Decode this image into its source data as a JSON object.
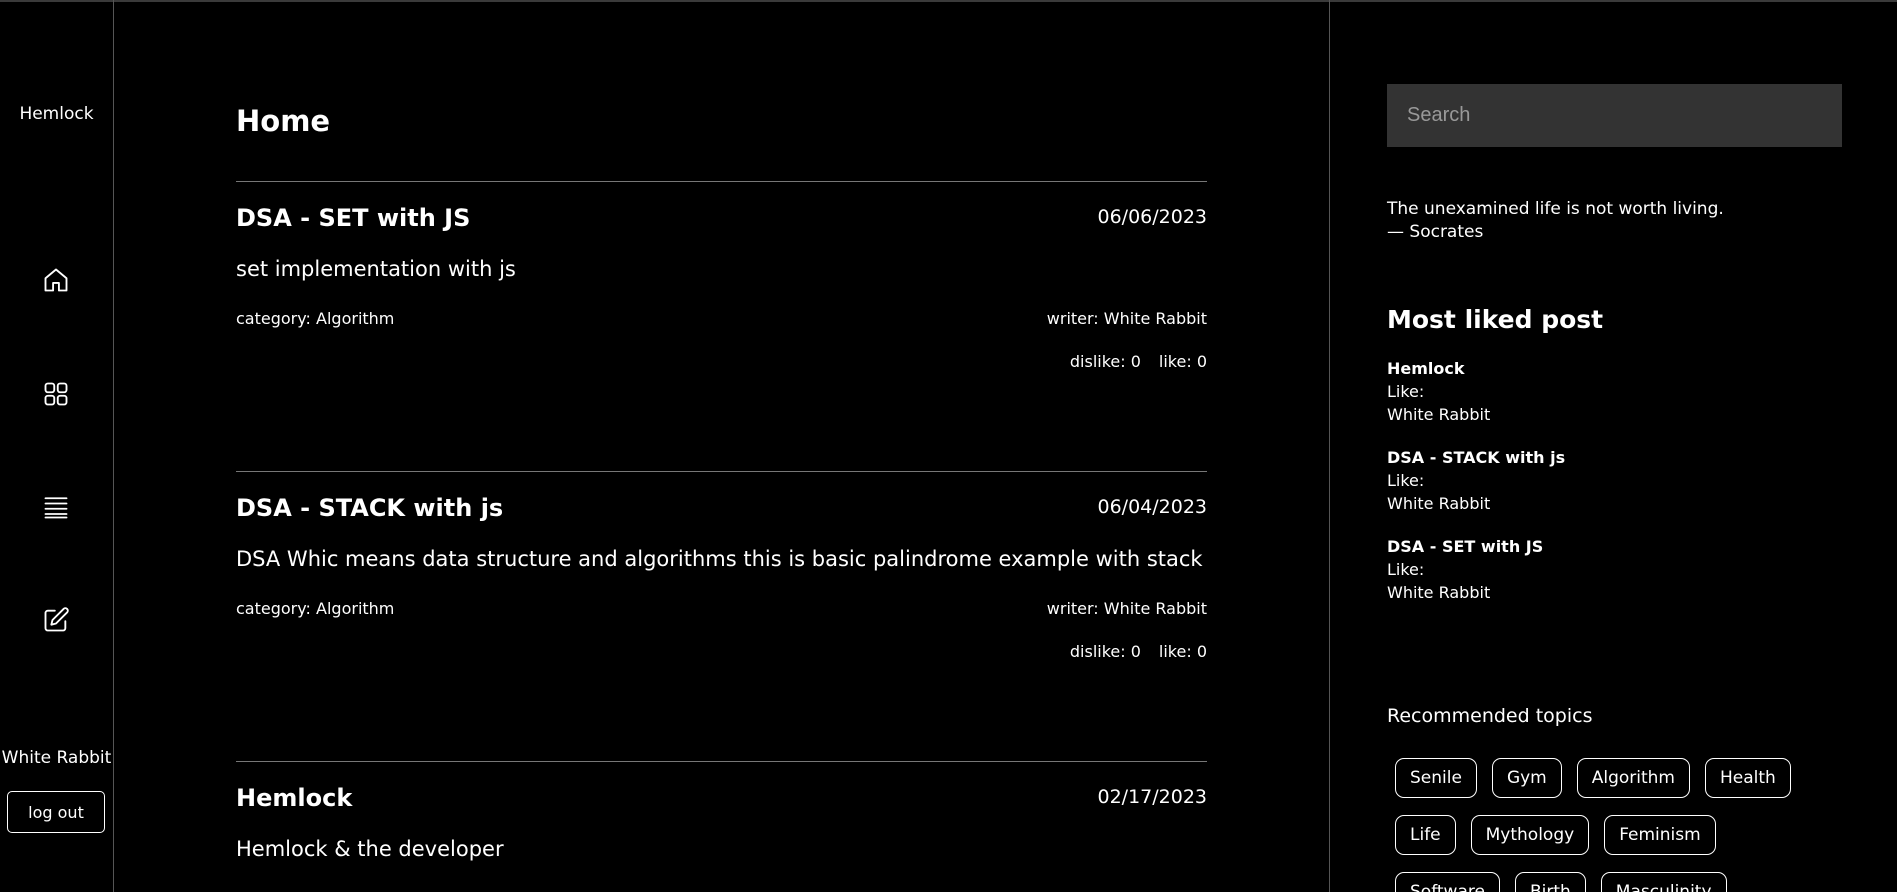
{
  "sidebar": {
    "brand": "Hemlock",
    "nav": [
      {
        "name": "home-icon"
      },
      {
        "name": "grid-icon"
      },
      {
        "name": "list-icon"
      },
      {
        "name": "edit-icon"
      }
    ],
    "user": "White Rabbit",
    "logout_label": "log out"
  },
  "main": {
    "title": "Home",
    "posts": [
      {
        "title": "DSA - SET with JS",
        "date": "06/06/2023",
        "description": "set implementation with js",
        "category": "category: Algorithm",
        "writer": "writer: White Rabbit",
        "dislike": "dislike: 0",
        "like": "like: 0"
      },
      {
        "title": "DSA - STACK with js",
        "date": "06/04/2023",
        "description": "DSA Whic means data structure and algorithms this is basic palindrome example with stack",
        "category": "category: Algorithm",
        "writer": "writer: White Rabbit",
        "dislike": "dislike: 0",
        "like": "like: 0"
      },
      {
        "title": "Hemlock",
        "date": "02/17/2023",
        "description": "Hemlock & the developer",
        "category": "",
        "writer": "",
        "dislike": "",
        "like": ""
      }
    ]
  },
  "right": {
    "search_placeholder": "Search",
    "quote_text": "The unexamined life is not worth living.",
    "quote_author": "— Socrates",
    "most_liked_title": "Most liked post",
    "most_liked": [
      {
        "title": "Hemlock",
        "like": "Like:",
        "writer": "White Rabbit"
      },
      {
        "title": "DSA - STACK with js",
        "like": "Like:",
        "writer": "White Rabbit"
      },
      {
        "title": "DSA - SET with JS",
        "like": "Like:",
        "writer": "White Rabbit"
      }
    ],
    "recommended_title": "Recommended topics",
    "topics": [
      "Senile",
      "Gym",
      "Algorithm",
      "Health",
      "Life",
      "Mythology",
      "Feminism",
      "Software",
      "Birth",
      "Masculinity"
    ]
  }
}
